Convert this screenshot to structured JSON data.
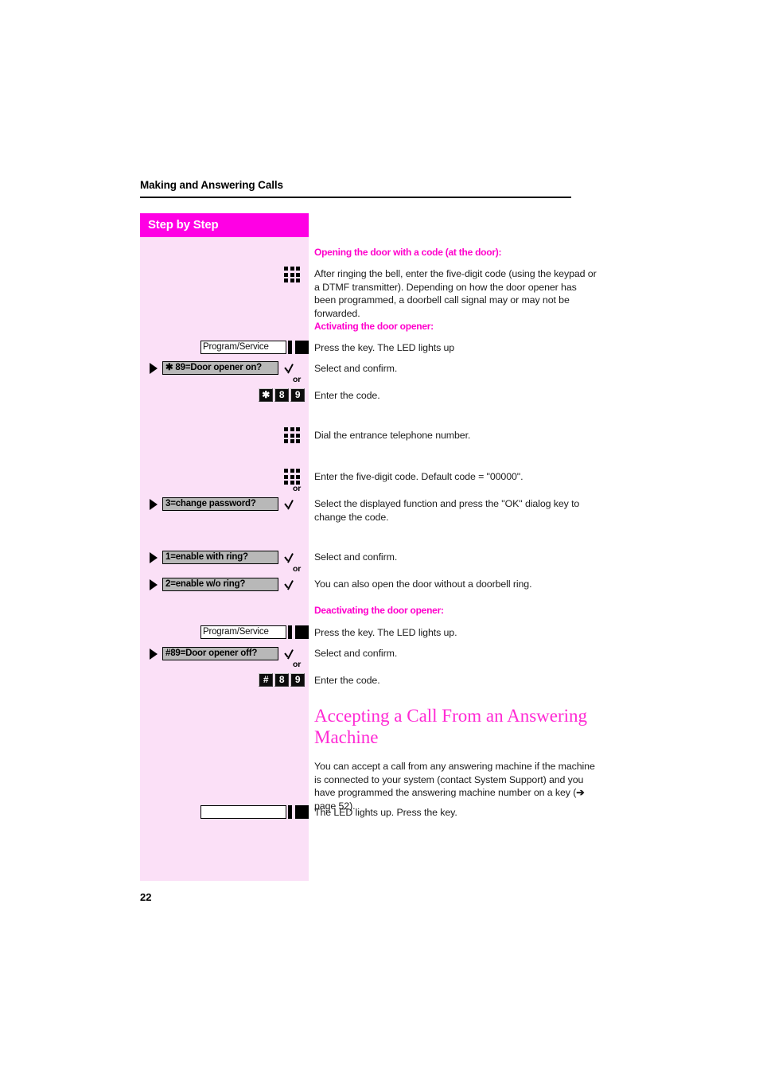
{
  "page": {
    "running_header": "Making and Answering Calls",
    "folio": "22"
  },
  "sidebar": {
    "title": "Step by Step"
  },
  "colors": {
    "magenta_bar": "#ff00e4",
    "panel_pink": "#fbe0f7",
    "heading_magenta": "#ff00cc",
    "section_heading": "#ff2ad4",
    "display_gray": "#b8b8b8"
  },
  "sections": [
    {
      "id": "opening-door-code",
      "heading": "Opening the door with a code (at the door):",
      "body": "After ringing the bell, enter the five-digit code (using the keypad or a DTMF transmitter). Depending on how the door opener has been programmed, a doorbell call signal may or may not be forwarded."
    },
    {
      "id": "activating-door-opener",
      "heading": "Activating the door opener:"
    },
    {
      "id": "deactivating-door-opener",
      "heading": "Deactivating the door opener:"
    }
  ],
  "steps": {
    "keypad_icon": "keypad-icon",
    "program_service_key_label": "Program/Service",
    "door_opener_on_option": "✱ 89=Door opener on?",
    "door_opener_off_option": "#89=Door opener off?",
    "change_password_option": "3=change password?",
    "enable_with_ring_option": "1=enable with ring?",
    "enable_wo_ring_option": "2=enable w/o ring?",
    "or_label": "or",
    "code_on_keys": [
      "✱",
      "8",
      "9"
    ],
    "code_off_keys": [
      "#",
      "8",
      "9"
    ],
    "blank_key_label": ""
  },
  "instructions": {
    "press_key_led_lights_up": "Press the key. The LED lights up",
    "select_and_confirm": "Select and confirm.",
    "enter_the_code": "Enter the code.",
    "dial_entrance_number": "Dial the entrance telephone number.",
    "enter_five_digit_default": "Enter the five-digit code. Default code = \"00000\".",
    "select_displayed_function": "Select the displayed function and press the \"OK\" dialog key to change the code.",
    "select_and_confirm_2": "Select and confirm.",
    "open_without_ring": "You can also open the door without a doorbell ring.",
    "press_key_led_lights_up_2": "Press the key. The LED lights up.",
    "select_and_confirm_3": "Select and confirm.",
    "enter_the_code_2": "Enter the code.",
    "led_lights_press_key": "The LED lights up. Press the key."
  },
  "answering_machine": {
    "heading": "Accepting a Call From an Answering Machine",
    "body_part1": "You can accept a call from any answering machine if the machine is connected to your system (contact System Support) and you have programmed the answering machine number on a key (",
    "arrow": "➔",
    "body_part2": " page 52).",
    "cross_reference": "page 52"
  }
}
